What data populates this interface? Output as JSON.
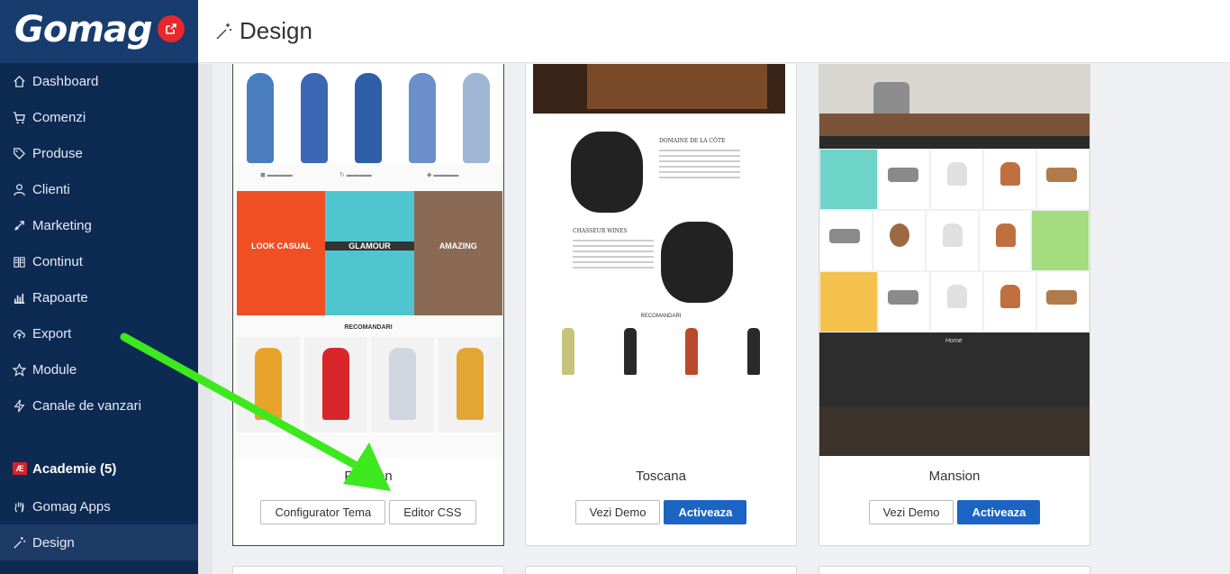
{
  "brand": {
    "logo_text": "Gomag"
  },
  "header": {
    "title": "Design"
  },
  "sidebar": {
    "items": [
      {
        "label": "Dashboard",
        "icon": "home-icon"
      },
      {
        "label": "Comenzi",
        "icon": "cart-icon"
      },
      {
        "label": "Produse",
        "icon": "tag-icon"
      },
      {
        "label": "Clienti",
        "icon": "user-icon"
      },
      {
        "label": "Marketing",
        "icon": "rocket-icon"
      },
      {
        "label": "Continut",
        "icon": "book-icon"
      },
      {
        "label": "Rapoarte",
        "icon": "bar-chart-icon"
      },
      {
        "label": "Export",
        "icon": "cloud-upload-icon"
      },
      {
        "label": "Module",
        "icon": "star-icon"
      },
      {
        "label": "Canale de vanzari",
        "icon": "bolt-icon"
      }
    ],
    "academie": {
      "label": "Academie (5)",
      "badge": "Æ"
    },
    "apps": {
      "label": "Gomag Apps"
    },
    "design": {
      "label": "Design"
    }
  },
  "themes": [
    {
      "name": "Fashion",
      "buttons": {
        "config": "Configurator Tema",
        "css": "Editor CSS"
      },
      "preview": {
        "banners": [
          "LOOK CASUAL",
          "GLAMOUR",
          "AMAZING"
        ],
        "rec_title": "RECOMANDARI"
      }
    },
    {
      "name": "Toscana",
      "buttons": {
        "demo": "Vezi Demo",
        "activate": "Activeaza"
      },
      "preview": {
        "heading1": "DOMAINE DE LA CÔTE",
        "heading2": "CHASSEUR WINES",
        "rec_title": "RECOMANDARI"
      }
    },
    {
      "name": "Mansion",
      "buttons": {
        "demo": "Vezi Demo",
        "activate": "Activeaza"
      },
      "preview": {
        "footer_title": "Home"
      }
    }
  ],
  "colors": {
    "sidebar_bg": "#0d2a53",
    "primary_button": "#1b64c4",
    "logo_badge": "#e8282b",
    "arrow": "#3ee81f"
  }
}
